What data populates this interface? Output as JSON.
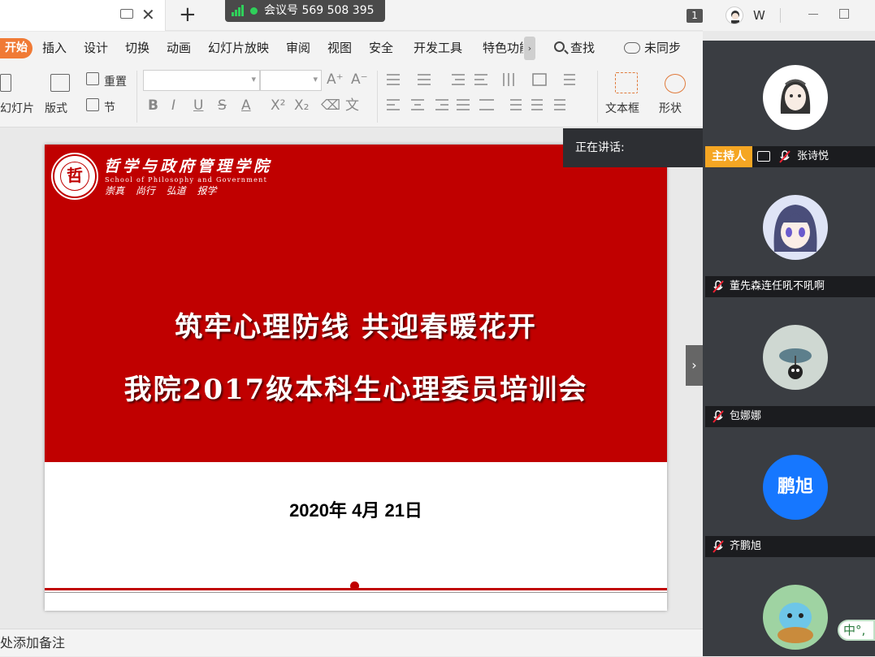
{
  "titlebar": {
    "close_glyph": "✕",
    "new_tab_glyph": "+",
    "meeting_id": "会议号 569 508 395",
    "window_count": "1",
    "user_initial": "W"
  },
  "menu": {
    "start": "开始",
    "items": [
      "插入",
      "设计",
      "切换",
      "动画",
      "幻灯片放映",
      "审阅",
      "视图",
      "安全",
      "开发工具",
      "特色功能"
    ],
    "more_glyph": "›",
    "search": "查找",
    "sync": "未同步"
  },
  "ribbon": {
    "new_slide": "幻灯片",
    "layout": "版式",
    "reset": "重置",
    "section": "节",
    "text_box": "文本框",
    "shape": "形状",
    "font_buttons": [
      "B",
      "I",
      "U",
      "S",
      "A",
      "X²",
      "X₂",
      "⌫",
      "文"
    ],
    "font_size_up": "A⁺",
    "font_size_down": "A⁻"
  },
  "slide": {
    "school_cn": "哲学与政府管理学院",
    "school_en": "School of Philosophy and Government",
    "school_motto": "崇真 尚行 弘道 报学",
    "logo_glyph": "哲",
    "title_line1": "筑牢心理防线 共迎春暖花开",
    "title_line2": "我院2017级本科生心理委员培训会",
    "date": "2020年 4月 21日"
  },
  "notes_placeholder": "单击此处添加备注",
  "speaking_label": "正在讲话:",
  "participants": [
    {
      "name": "张诗悦",
      "host_badge": "主持人",
      "avatar": "user-avatar",
      "avatar_text": ""
    },
    {
      "name": "董先森连任吼不吼啊",
      "avatar": "user-avatar",
      "avatar_text": ""
    },
    {
      "name": "包娜娜",
      "avatar": "user-avatar",
      "avatar_text": ""
    },
    {
      "name": "齐鹏旭",
      "avatar": "initials-avatar",
      "avatar_text": "鹏旭"
    },
    {
      "name": "",
      "avatar": "user-avatar",
      "avatar_text": ""
    }
  ],
  "ime": "中°,",
  "colors": {
    "accent_orange": "#f07a35",
    "slide_red": "#c00000",
    "host_badge": "#f5a623",
    "initials_blue": "#1677ff"
  }
}
